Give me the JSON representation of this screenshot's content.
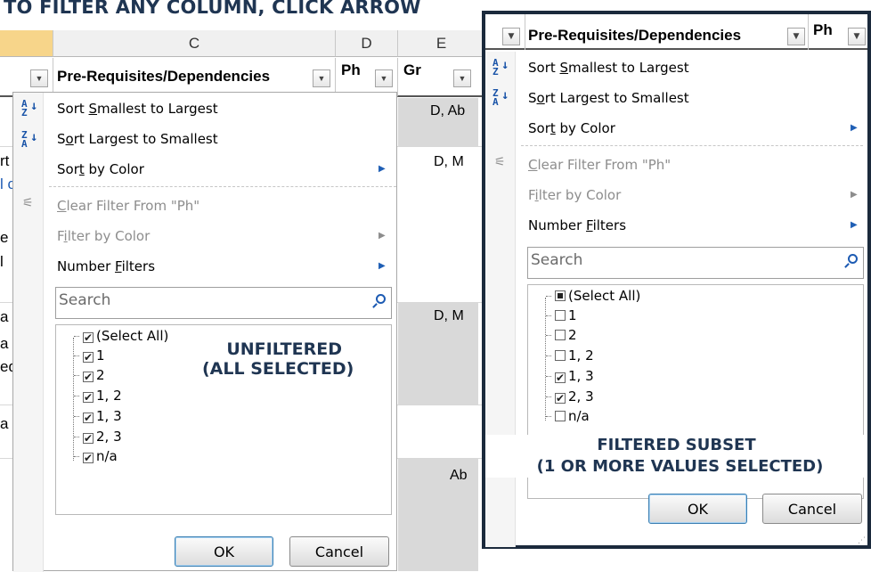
{
  "title": "TO FILTER ANY COLUMN, CLICK ARROW",
  "sheet": {
    "col_c": "C",
    "col_d": "D",
    "col_e": "E",
    "hdr_c": "Pre-Requisites/Dependencies",
    "hdr_d": "Ph",
    "hdr_e": "Gr",
    "e_values": [
      "D, Ab",
      "D, M",
      "D, M",
      "Ab"
    ],
    "left_fragments": [
      "rt",
      "l c",
      "e",
      "l",
      "a",
      "a",
      "ed",
      "a"
    ]
  },
  "left_menu": {
    "sort_asc": [
      "Sort ",
      "S",
      "mallest to Largest"
    ],
    "sort_desc": [
      "S",
      "o",
      "rt Largest to Smallest"
    ],
    "sort_color": [
      "Sor",
      "t",
      " by Color"
    ],
    "clear_filter": [
      "",
      "C",
      "lear Filter From \"Ph\""
    ],
    "filter_color": [
      "F",
      "i",
      "lter by Color"
    ],
    "number_filters": [
      "Number ",
      "F",
      "ilters"
    ],
    "search_placeholder": "Search",
    "items": [
      "(Select All)",
      "1",
      "2",
      "1, 2",
      "1, 3",
      "2, 3",
      "n/a"
    ],
    "annotation_line1": "UNFILTERED",
    "annotation_line2": "(ALL SELECTED)",
    "ok": "OK",
    "cancel": "Cancel"
  },
  "right_menu": {
    "hdr_c": "Pre-Requisites/Dependencies",
    "hdr_d": "Ph",
    "search_placeholder": "Search",
    "items": [
      "(Select All)",
      "1",
      "2",
      "1, 2",
      "1, 3",
      "2, 3",
      "n/a"
    ],
    "checked": [
      false,
      false,
      false,
      false,
      true,
      true,
      false
    ],
    "annotation_line1": "FILTERED SUBSET",
    "annotation_line2": "(1 OR MORE VALUES SELECTED)",
    "ok": "OK",
    "cancel": "Cancel"
  },
  "colors": {
    "title": "#1f3552",
    "accent": "#1d5bb3",
    "frame": "#1b2a3c"
  }
}
